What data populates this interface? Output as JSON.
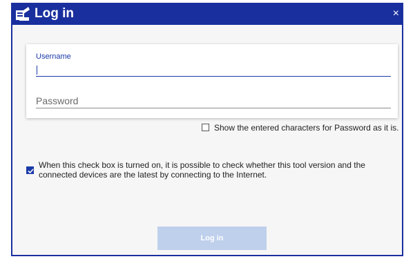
{
  "window": {
    "title": "Log in",
    "close_glyph": "×",
    "icon": "app-icon",
    "accent": "#1a2f9e"
  },
  "login_form": {
    "username_label": "Username",
    "username_value": "",
    "password_placeholder": "Password",
    "password_value": ""
  },
  "show_password": {
    "checked": false,
    "label": "Show the entered characters for Password as it is."
  },
  "update_check": {
    "checked": true,
    "label": "When this check box is turned on, it is possible to check whether this tool version and the connected devices are the latest by connecting to the Internet."
  },
  "login_button": {
    "label": "Log in",
    "enabled": false,
    "color": "#bfd0ec"
  }
}
